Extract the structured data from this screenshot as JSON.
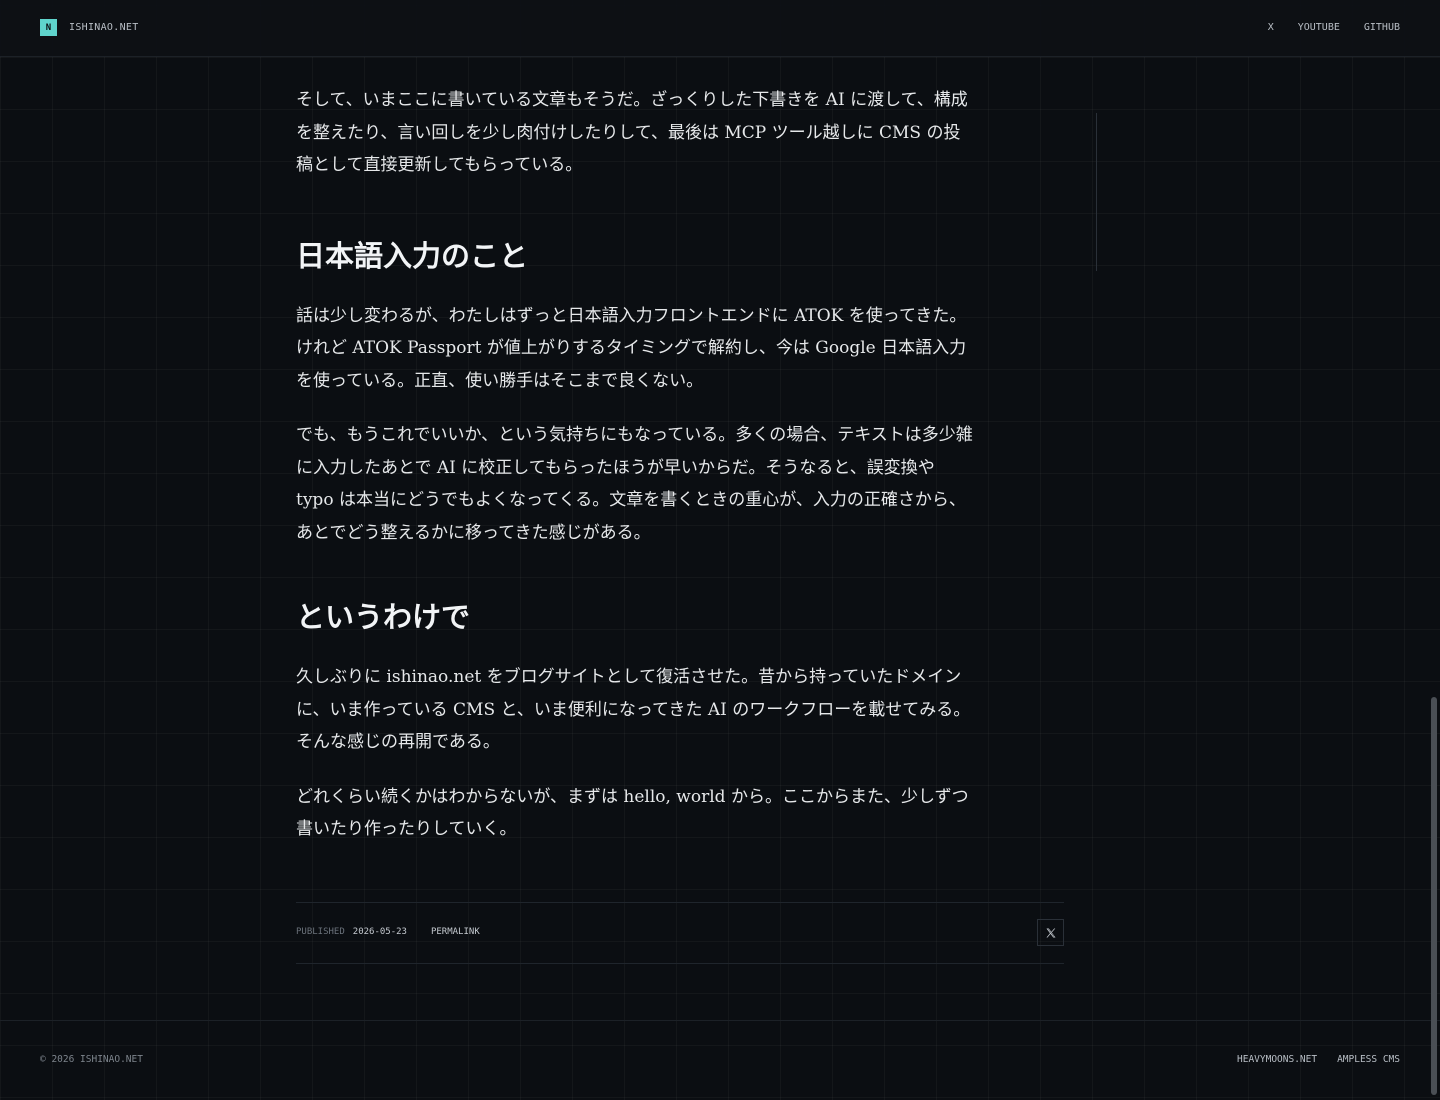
{
  "header": {
    "brand_mark": "N",
    "brand_name": "ISHINAO.NET",
    "nav": [
      "X",
      "YOUTUBE",
      "GITHUB"
    ]
  },
  "article": {
    "p_intro": "そして、いまここに書いている文章もそうだ。ざっくりした下書きを AI に渡して、構成を整えたり、言い回しを少し肉付けしたりして、最後は MCP ツール越しに CMS の投稿として直接更新してもらっている。",
    "h_ime": "日本語入力のこと",
    "p_ime_1": "話は少し変わるが、わたしはずっと日本語入力フロントエンドに ATOK を使ってきた。けれど ATOK Passport が値上がりするタイミングで解約し、今は Google 日本語入力を使っている。正直、使い勝手はそこまで良くない。",
    "p_ime_2": "でも、もうこれでいいか、という気持ちにもなっている。多くの場合、テキストは多少雑に入力したあとで AI に校正してもらったほうが早いからだ。そうなると、誤変換や typo は本当にどうでもよくなってくる。文章を書くときの重心が、入力の正確さから、あとでどう整えるかに移ってきた感じがある。",
    "h_end": "というわけで",
    "p_end_1": "久しぶりに ishinao.net をブログサイトとして復活させた。昔から持っていたドメインに、いま作っている CMS と、いま便利になってきた AI のワークフローを載せてみる。そんな感じの再開である。",
    "p_end_2": "どれくらい続くかはわからないが、まずは hello, world から。ここからまた、少しずつ書いたり作ったりしていく。"
  },
  "meta": {
    "published_label": "PUBLISHED",
    "published_date": "2026-05-23",
    "permalink": "PERMALINK",
    "share_icon": "x-logo-icon"
  },
  "footer": {
    "copyright": "© 2026 ISHINAO.NET",
    "links": [
      "HEAVYMOONS.NET",
      "AMPLESS CMS"
    ]
  },
  "colors": {
    "background": "#0b0e12",
    "accent": "#5fd4cc",
    "text": "#e6e8ea"
  }
}
